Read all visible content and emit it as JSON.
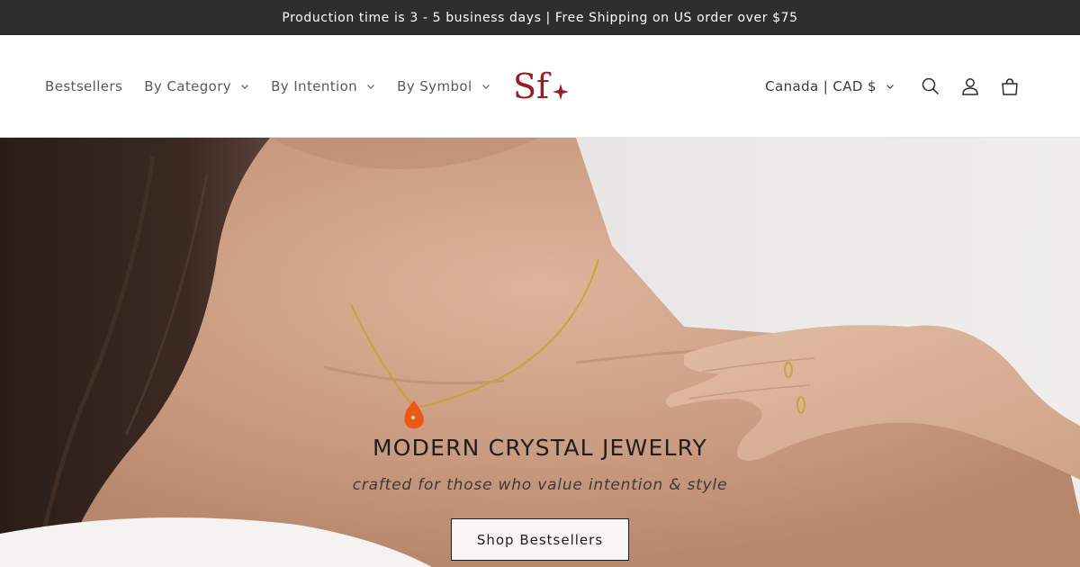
{
  "announcement": {
    "text": "Production time is 3 - 5 business days | Free Shipping on US order over $75"
  },
  "header": {
    "nav": [
      {
        "label": "Bestsellers",
        "has_dropdown": false
      },
      {
        "label": "By Category",
        "has_dropdown": true
      },
      {
        "label": "By Intention",
        "has_dropdown": true
      },
      {
        "label": "By Symbol",
        "has_dropdown": true
      }
    ],
    "logo_text": "Sf",
    "locale": "Canada | CAD $",
    "icons": [
      "search-icon",
      "account-icon",
      "cart-icon"
    ]
  },
  "hero": {
    "title": "MODERN CRYSTAL JEWELRY",
    "subtitle": "crafted for those who value intention & style",
    "button_label": "Shop Bestsellers"
  },
  "colors": {
    "announcement_bg": "#2e2e2e",
    "logo": "#9b1b24",
    "pendant": "#ea5a16",
    "chain": "#c9a23a"
  }
}
